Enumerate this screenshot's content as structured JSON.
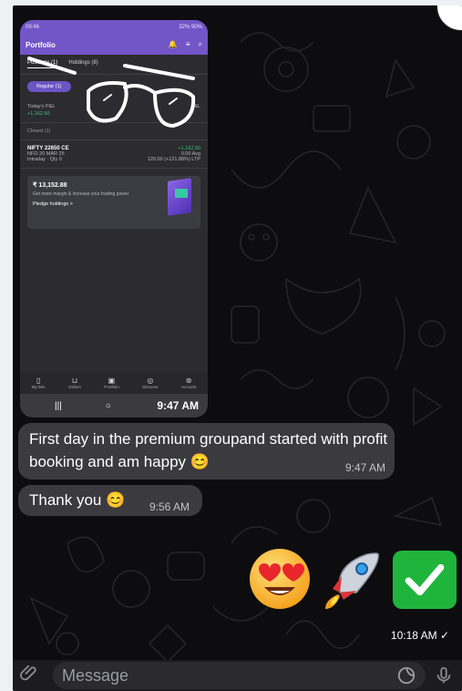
{
  "screenshot": {
    "status_time": "09:46",
    "status_right": "32% 90%",
    "app_title": "Portfolio",
    "tabs": [
      "Positions (1)",
      "Holdings (8)"
    ],
    "filter_label": "Regular (1)",
    "todays_pnl_label": "Today's P&L",
    "todays_pnl_value": "+1,162.50",
    "total_pnl_label": "P&L",
    "closed_label": "Closed (1)",
    "position_name": "NIFTY 22650 CE",
    "position_sub": "NFO 20 MAR 25",
    "position_type": "Intraday · Qty 0",
    "position_pnl": "+1,162.50",
    "position_avg": "0.00 Avg",
    "position_ltp": "120.00 (+121.88%) LTP",
    "pledge_amount": "₹ 13,152.88",
    "pledge_text": "Get more margin & increase your trading power",
    "pledge_link": "Pledge holdings >",
    "nav_items": [
      "My lists",
      "Orders",
      "Portfolio",
      "Discover",
      "Account"
    ],
    "time": "9:47 AM"
  },
  "messages": [
    {
      "text": "First day in the premium groupand started with profit booking and am happy 😊",
      "time": "9:47 AM"
    },
    {
      "text": "Thank you 😊",
      "time": "9:56 AM"
    }
  ],
  "emoji_message": {
    "time": "10:18 AM"
  },
  "input": {
    "placeholder": "Message"
  },
  "colors": {
    "app_purple": "#7255c7",
    "bubble": "#3a3a3f",
    "check_green": "#1fb53c",
    "profit_green": "#3fc379"
  }
}
